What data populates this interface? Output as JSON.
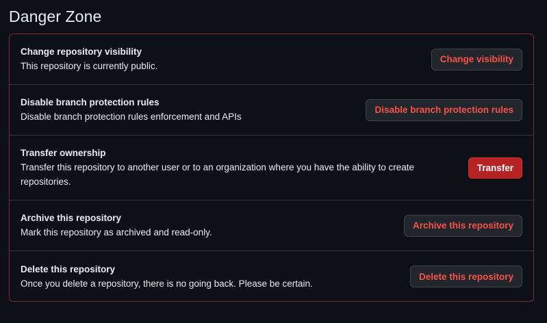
{
  "header": {
    "title": "Danger Zone"
  },
  "rows": [
    {
      "title": "Change repository visibility",
      "description": "This repository is currently public.",
      "button": "Change visibility"
    },
    {
      "title": "Disable branch protection rules",
      "description": "Disable branch protection rules enforcement and APIs",
      "button": "Disable branch protection rules"
    },
    {
      "title": "Transfer ownership",
      "description": "Transfer this repository to another user or to an organization where you have the ability to create repositories.",
      "button": "Transfer"
    },
    {
      "title": "Archive this repository",
      "description": "Mark this repository as archived and read-only.",
      "button": "Archive this repository"
    },
    {
      "title": "Delete this repository",
      "description": "Once you delete a repository, there is no going back. Please be certain.",
      "button": "Delete this repository"
    }
  ],
  "colors": {
    "background": "#0d1117",
    "danger_text": "#f85149",
    "danger_border": "#7a2d2d",
    "transfer_button": "#b62324"
  }
}
